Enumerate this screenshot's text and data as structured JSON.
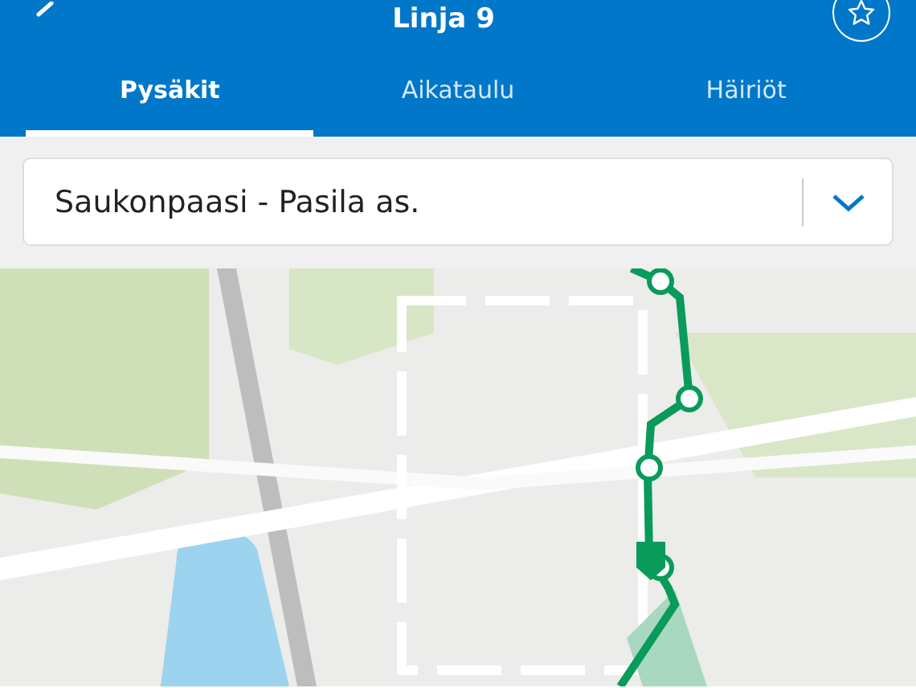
{
  "header": {
    "title": "Linja 9"
  },
  "tabs": [
    {
      "label": "Pysäkit",
      "selected": true
    },
    {
      "label": "Aikataulu",
      "selected": false
    },
    {
      "label": "Häiriöt",
      "selected": false
    }
  ],
  "route_select": {
    "value": "Saukonpaasi - Pasila as."
  }
}
